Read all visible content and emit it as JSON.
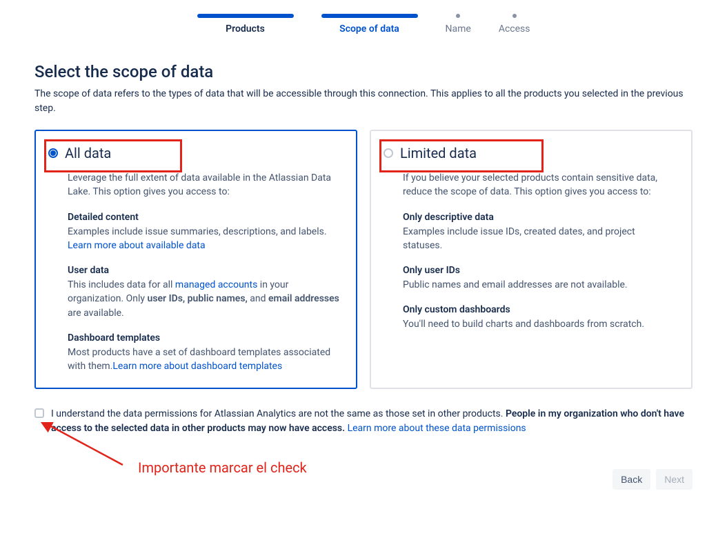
{
  "stepper": {
    "steps": [
      {
        "label": "Products",
        "state": "done"
      },
      {
        "label": "Scope of data",
        "state": "active"
      },
      {
        "label": "Name",
        "state": "future"
      },
      {
        "label": "Access",
        "state": "future"
      }
    ]
  },
  "page": {
    "title": "Select the scope of data",
    "description": "The scope of data refers to the types of data that will be accessible through this connection. This applies to all the products you selected in the previous step."
  },
  "cards": {
    "all": {
      "title": "All data",
      "intro": "Leverage the full extent of data available in the Atlassian Data Lake. This option gives you access to:",
      "s1_title": "Detailed content",
      "s1_desc": "Examples include issue summaries, descriptions, and labels. ",
      "s1_link": "Learn more about available data",
      "s2_title": "User data",
      "s2_desc_pre": "This includes data for all ",
      "s2_link": "managed accounts",
      "s2_desc_mid": " in your organization. Only ",
      "s2_bold1": "user IDs, public names,",
      "s2_and": " and ",
      "s2_bold2": "email addresses",
      "s2_desc_post": " are available.",
      "s3_title": "Dashboard templates",
      "s3_desc": "Most products have a set of dashboard templates associated with them.",
      "s3_link": "Learn more about dashboard templates"
    },
    "limited": {
      "title": "Limited data",
      "intro": "If you believe your selected products contain sensitive data, reduce the scope of data. This option gives you access to:",
      "s1_title": "Only descriptive data",
      "s1_desc": "Examples include issue IDs, created dates, and project statuses.",
      "s2_title": "Only user IDs",
      "s2_desc": "Public names and email addresses are not available.",
      "s3_title": "Only custom dashboards",
      "s3_desc": "You'll need to build charts and dashboards from scratch."
    }
  },
  "ack": {
    "text_pre": "I understand the data permissions for Atlassian Analytics are not the same as those set in other products. ",
    "text_bold": "People in my organization who don't have access to the selected data in other products may now have access.",
    "link": "Learn more about these data permissions"
  },
  "annotation": {
    "label": "Importante marcar el check"
  },
  "footer": {
    "back": "Back",
    "next": "Next"
  }
}
